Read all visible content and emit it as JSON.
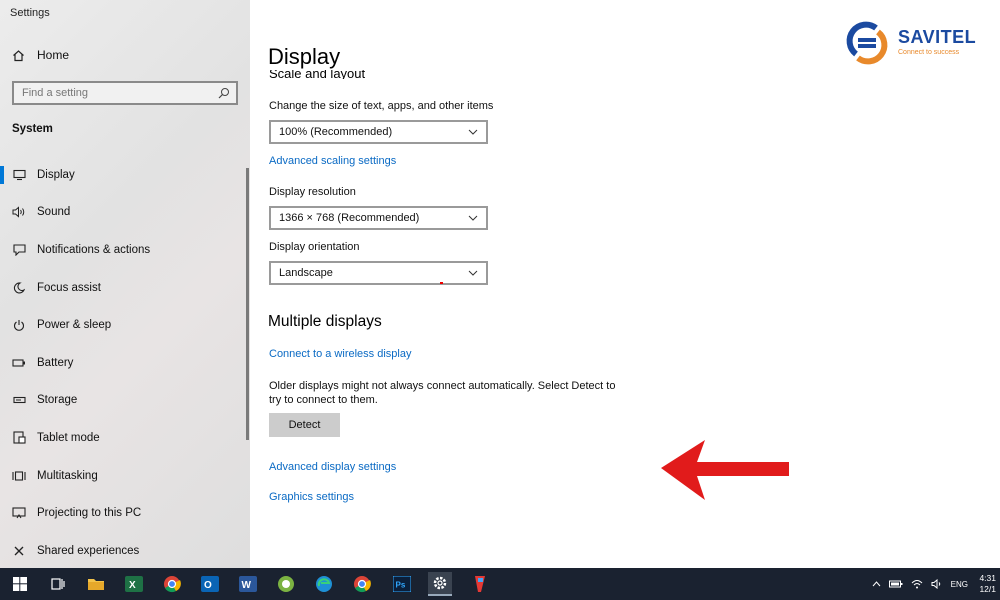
{
  "window": {
    "title": "Settings"
  },
  "sidebar": {
    "home_label": "Home",
    "search_placeholder": "Find a setting",
    "section_title": "System",
    "items": [
      {
        "label": "Display",
        "icon": "monitor-icon",
        "active": true
      },
      {
        "label": "Sound",
        "icon": "speaker-icon"
      },
      {
        "label": "Notifications & actions",
        "icon": "notification-icon"
      },
      {
        "label": "Focus assist",
        "icon": "moon-icon"
      },
      {
        "label": "Power & sleep",
        "icon": "power-icon"
      },
      {
        "label": "Battery",
        "icon": "battery-icon"
      },
      {
        "label": "Storage",
        "icon": "storage-icon"
      },
      {
        "label": "Tablet mode",
        "icon": "tablet-icon"
      },
      {
        "label": "Multitasking",
        "icon": "multitasking-icon"
      },
      {
        "label": "Projecting to this PC",
        "icon": "projecting-icon"
      },
      {
        "label": "Shared experiences",
        "icon": "shared-icon"
      }
    ]
  },
  "main": {
    "title": "Display",
    "scale_heading": "Scale and layout",
    "scale_label": "Change the size of text, apps, and other items",
    "scale_value": "100% (Recommended)",
    "advanced_scaling_link": "Advanced scaling settings",
    "resolution_label": "Display resolution",
    "resolution_value": "1366 × 768 (Recommended)",
    "orientation_label": "Display orientation",
    "orientation_value": "Landscape",
    "multiple_heading": "Multiple displays",
    "wireless_link": "Connect to a wireless display",
    "detect_text": "Older displays might not always connect automatically. Select Detect to try to connect to them.",
    "detect_button": "Detect",
    "advanced_display_link": "Advanced display settings",
    "graphics_link": "Graphics settings"
  },
  "logo": {
    "brand": "SAVITEL",
    "tagline": "Connect to success"
  },
  "taskbar": {
    "language": "ENG",
    "time": "4:31",
    "date": "12/1"
  },
  "colors": {
    "accent": "#0078d7",
    "link": "#0a6ac4",
    "arrow": "#e11b1b",
    "taskbar": "#1a2230",
    "brand": "#1b4aa0",
    "brand_orange": "#e8892b"
  }
}
